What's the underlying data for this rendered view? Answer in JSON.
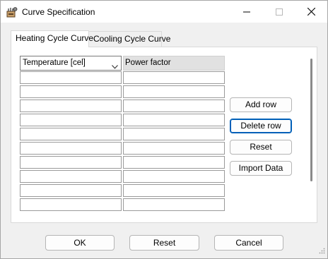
{
  "window": {
    "title": "Curve Specification",
    "icons": {
      "app": "gear-settings-icon",
      "minimize": "minimize-icon",
      "maximize": "maximize-icon",
      "close": "close-icon"
    }
  },
  "tabs": [
    {
      "label": "Heating Cycle Curve",
      "active": true
    },
    {
      "label": "Cooling Cycle Curve",
      "active": false
    }
  ],
  "table": {
    "column1_selected": "Temperature [cel]",
    "column2_header": "Power factor",
    "row_count": 10
  },
  "actions": {
    "add_row": "Add row",
    "delete_row": "Delete row",
    "reset": "Reset",
    "import_data": "Import Data"
  },
  "footer": {
    "ok": "OK",
    "reset": "Reset",
    "cancel": "Cancel"
  },
  "colors": {
    "accent": "#005fb8",
    "header_bg": "#e1e1e1"
  }
}
